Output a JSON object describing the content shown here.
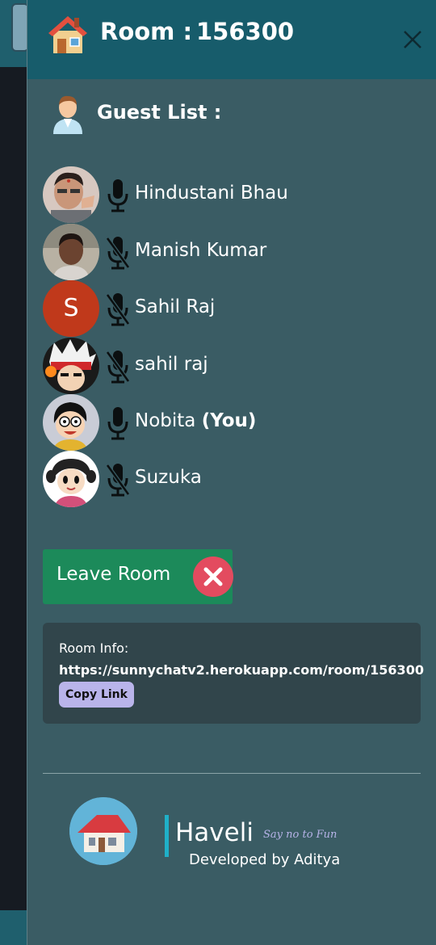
{
  "header": {
    "title_label": "Room :",
    "room_id": "156300",
    "icons": {
      "house": "house-icon",
      "close": "close-icon"
    }
  },
  "guest_list": {
    "title": "Guest List :",
    "icon": "person-icon",
    "guests": [
      {
        "name": "Hindustani Bhau",
        "suffix": "",
        "mic": "mic-on-icon",
        "avatar": "photo"
      },
      {
        "name": "Manish Kumar",
        "suffix": "",
        "mic": "mic-off-icon",
        "avatar": "photo"
      },
      {
        "name": "Sahil Raj",
        "suffix": "",
        "mic": "mic-off-icon",
        "avatar_letter": "S",
        "avatar_color": "#c0391b"
      },
      {
        "name": "sahil raj",
        "suffix": "",
        "mic": "mic-off-icon",
        "avatar": "anime"
      },
      {
        "name": "Nobita",
        "suffix": "(You)",
        "mic": "mic-on-icon",
        "avatar": "cartoon"
      },
      {
        "name": "Suzuka",
        "suffix": "",
        "mic": "mic-off-icon",
        "avatar": "cartoon"
      }
    ]
  },
  "leave": {
    "label": "Leave Room",
    "icon": "x-circle-icon",
    "color": "#1c8a5a"
  },
  "room_info": {
    "label": "Room Info:",
    "url": "https://sunnychatv2.herokuapp.com/room/156300",
    "copy_label": "Copy Link"
  },
  "footer": {
    "brand": "Haveli",
    "tagline": "Say no to Fun",
    "developer": "Developed by Aditya",
    "logo": "house-logo-icon"
  },
  "colors": {
    "header_bg": "#175c6b",
    "panel_bg": "#3a5c64",
    "info_bg": "#31454b",
    "copy_btn": "#b9b4ea",
    "accent_bar": "#1fb0c8"
  }
}
